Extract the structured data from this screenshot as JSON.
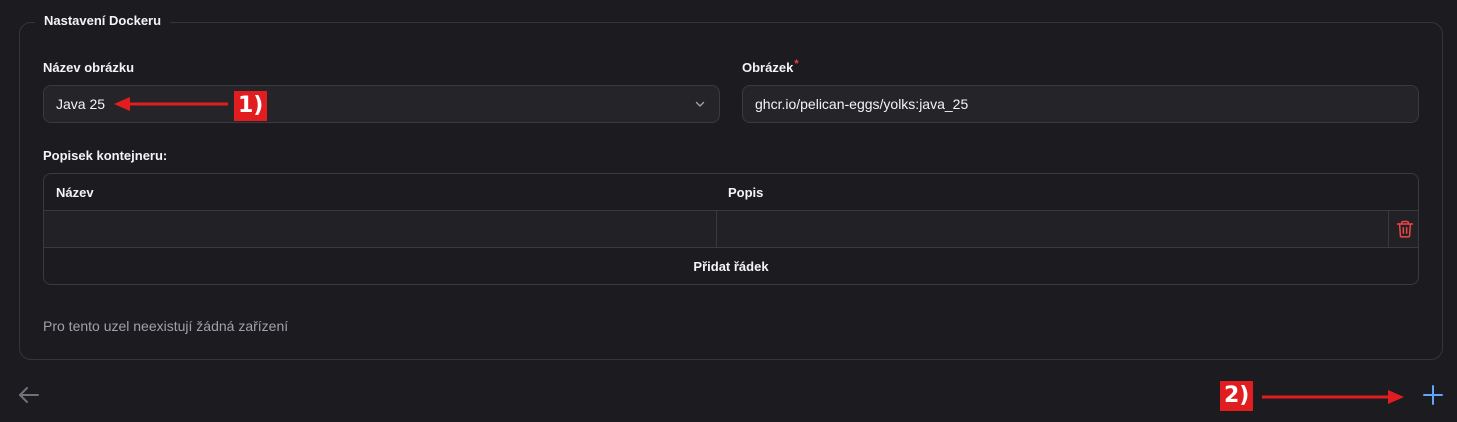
{
  "section": {
    "title": "Nastavení Dockeru"
  },
  "image_name": {
    "label": "Název obrázku",
    "value": "Java 25"
  },
  "image": {
    "label": "Obrázek",
    "required_mark": "*",
    "value": "ghcr.io/pelican-eggs/yolks:java_25"
  },
  "labels_table": {
    "label": "Popisek kontejneru:",
    "columns": [
      "Název",
      "Popis"
    ],
    "rows": [
      {
        "name": "",
        "description": ""
      }
    ],
    "add_row_label": "Přidat řádek"
  },
  "devices": {
    "empty_text": "Pro tento uzel neexistují žádná zařízení"
  },
  "annotations": {
    "one": "1)",
    "two": "2)"
  },
  "colors": {
    "annotation": "#e11d20",
    "accent": "#60a5fa",
    "danger": "#ef4444"
  },
  "icons": {
    "back": "arrow-left-icon",
    "add": "plus-icon",
    "delete": "trash-icon",
    "dropdown": "chevron-down-icon"
  }
}
